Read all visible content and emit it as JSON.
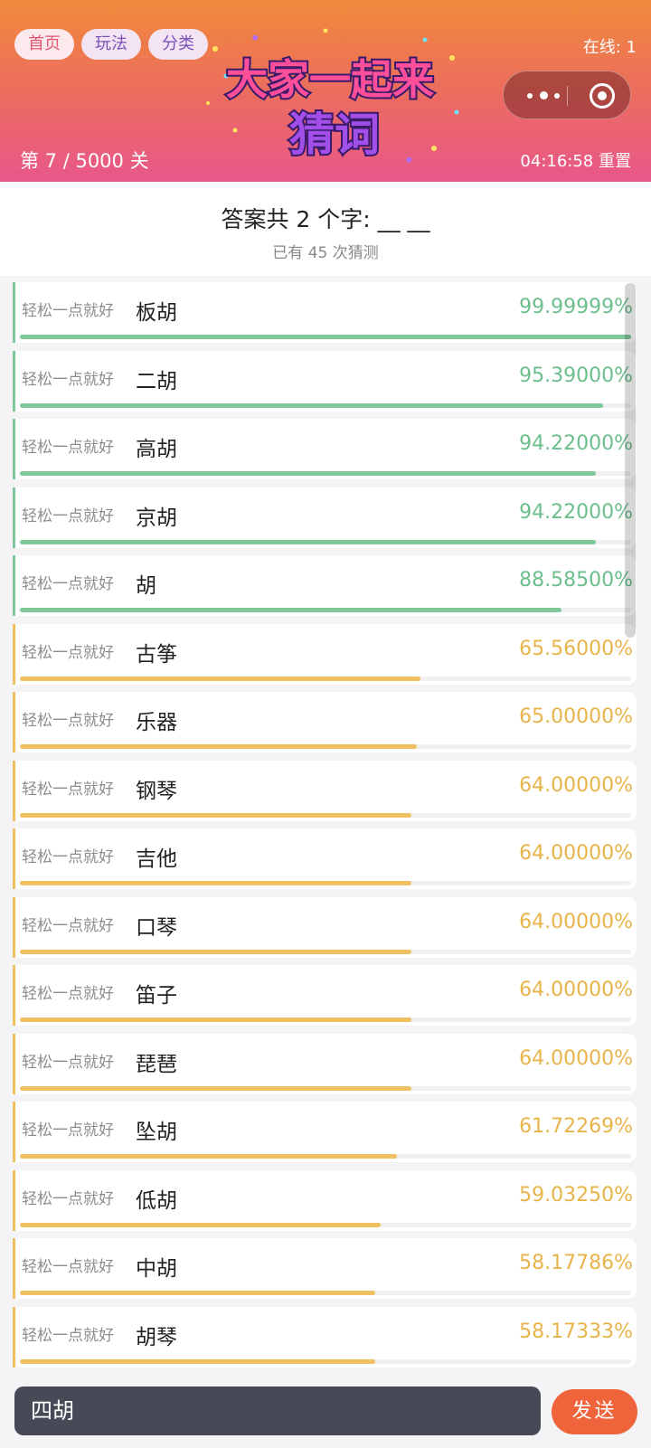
{
  "nav": {
    "home": "首页",
    "rules": "玩法",
    "category": "分类"
  },
  "online": "在线: 1",
  "logo_text": {
    "line1": "大家一起来",
    "line2": "猜词"
  },
  "level": "第 7 / 5000 关",
  "timer": "04:16:58 重置",
  "answer": {
    "title": "答案共 2 个字: __ __",
    "guess_count": "已有 45 次猜测"
  },
  "colors": {
    "high": "#7ec79a",
    "mid": "#f0c060",
    "high_text": "#6cbf8c",
    "mid_text": "#e8b44a"
  },
  "guesses": [
    {
      "user": "轻松一点就好",
      "word": "板胡",
      "percent": "99.99999%",
      "value": 99.99999,
      "tier": "high"
    },
    {
      "user": "轻松一点就好",
      "word": "二胡",
      "percent": "95.39000%",
      "value": 95.39,
      "tier": "high"
    },
    {
      "user": "轻松一点就好",
      "word": "高胡",
      "percent": "94.22000%",
      "value": 94.22,
      "tier": "high"
    },
    {
      "user": "轻松一点就好",
      "word": "京胡",
      "percent": "94.22000%",
      "value": 94.22,
      "tier": "high"
    },
    {
      "user": "轻松一点就好",
      "word": "胡",
      "percent": "88.58500%",
      "value": 88.585,
      "tier": "high"
    },
    {
      "user": "轻松一点就好",
      "word": "古筝",
      "percent": "65.56000%",
      "value": 65.56,
      "tier": "mid"
    },
    {
      "user": "轻松一点就好",
      "word": "乐器",
      "percent": "65.00000%",
      "value": 65.0,
      "tier": "mid"
    },
    {
      "user": "轻松一点就好",
      "word": "钢琴",
      "percent": "64.00000%",
      "value": 64.0,
      "tier": "mid"
    },
    {
      "user": "轻松一点就好",
      "word": "吉他",
      "percent": "64.00000%",
      "value": 64.0,
      "tier": "mid"
    },
    {
      "user": "轻松一点就好",
      "word": "口琴",
      "percent": "64.00000%",
      "value": 64.0,
      "tier": "mid"
    },
    {
      "user": "轻松一点就好",
      "word": "笛子",
      "percent": "64.00000%",
      "value": 64.0,
      "tier": "mid"
    },
    {
      "user": "轻松一点就好",
      "word": "琵琶",
      "percent": "64.00000%",
      "value": 64.0,
      "tier": "mid"
    },
    {
      "user": "轻松一点就好",
      "word": "坠胡",
      "percent": "61.72269%",
      "value": 61.72269,
      "tier": "mid"
    },
    {
      "user": "轻松一点就好",
      "word": "低胡",
      "percent": "59.03250%",
      "value": 59.0325,
      "tier": "mid"
    },
    {
      "user": "轻松一点就好",
      "word": "中胡",
      "percent": "58.17786%",
      "value": 58.17786,
      "tier": "mid"
    },
    {
      "user": "轻松一点就好",
      "word": "胡琴",
      "percent": "58.17333%",
      "value": 58.17333,
      "tier": "mid"
    }
  ],
  "input": {
    "value": "四胡"
  },
  "send_label": "发送"
}
